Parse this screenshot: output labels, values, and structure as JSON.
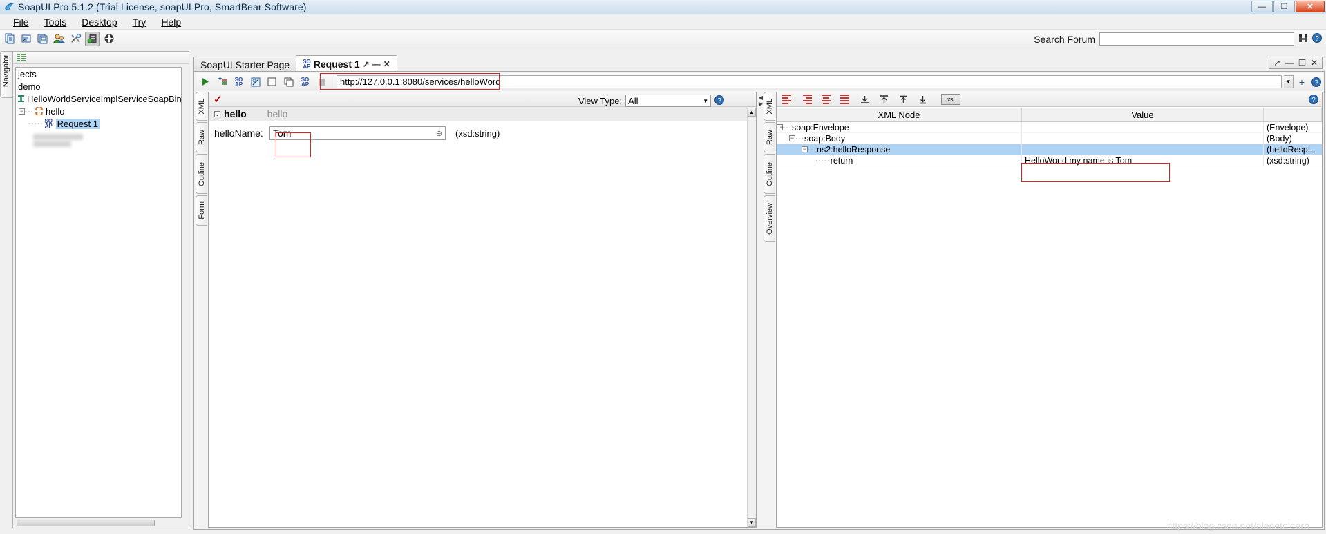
{
  "window": {
    "title": "SoapUI Pro 5.1.2 (Trial License, soapUI Pro, SmartBear Software)",
    "app_icon": "soapui-logo-icon",
    "minimize": "—",
    "restore": "❐",
    "close": "✕"
  },
  "menu": {
    "items": [
      {
        "label": "File"
      },
      {
        "label": "Tools"
      },
      {
        "label": "Desktop"
      },
      {
        "label": "Try"
      },
      {
        "label": "Help"
      }
    ]
  },
  "toolbar": {
    "buttons": [
      {
        "name": "new-project-icon",
        "glyph": "🗐"
      },
      {
        "name": "import-project-icon",
        "glyph": "🗗"
      },
      {
        "name": "save-all-icon",
        "glyph": "🗏"
      },
      {
        "name": "forum-icon",
        "glyph": "👥"
      },
      {
        "name": "preferences-icon",
        "glyph": "🛠"
      },
      {
        "name": "mockservice-icon",
        "glyph": "🖴"
      },
      {
        "name": "help-icon",
        "glyph": "✪"
      }
    ],
    "search_label": "Search Forum",
    "search_value": "",
    "search_placeholder": "",
    "search_go_icon": "binoculars-icon",
    "search_help_icon": "help-circle-icon"
  },
  "navigator": {
    "tab_label": "Navigator",
    "header_icon": "collapse-all-icon",
    "tree": [
      {
        "label": "jects",
        "indent": 0,
        "expander": "",
        "icon": ""
      },
      {
        "label": "demo",
        "indent": 0,
        "expander": "",
        "icon": ""
      },
      {
        "label": "HelloWorldServiceImplServiceSoapBind",
        "indent": 0,
        "expander": "",
        "icon": "interface-icon"
      },
      {
        "label": "hello",
        "indent": 1,
        "expander": "-",
        "icon": "operation-icon"
      },
      {
        "label": "Request 1",
        "indent": 2,
        "expander": "",
        "icon": "soap-request-icon",
        "selected": true
      }
    ]
  },
  "desktop": {
    "tabs": [
      {
        "label": "SoapUI Starter Page",
        "active": false,
        "icon": ""
      },
      {
        "label": "Request 1",
        "active": true,
        "icon": "soap-icon",
        "buttons": [
          "↗",
          "—",
          "✕"
        ]
      }
    ],
    "panel_buttons": [
      "↗",
      "—",
      "❐",
      "✕"
    ]
  },
  "request": {
    "toolbar_buttons": [
      {
        "name": "submit-request-button",
        "glyph": "▶"
      },
      {
        "name": "add-assertion-button",
        "glyph": "⁺"
      },
      {
        "name": "soap-format-button",
        "glyph": "SO"
      },
      {
        "name": "create-testcase-button",
        "glyph": "◳"
      },
      {
        "name": "one-way-button",
        "glyph": "◻"
      },
      {
        "name": "clone-request-button",
        "glyph": "❐"
      },
      {
        "name": "wsa-button",
        "glyph": "SO"
      },
      {
        "name": "stop-button",
        "glyph": "■"
      }
    ],
    "url": "http://127.0.0.1:8080/services/helloWord",
    "url_dropdown_icon": "chevron-down-icon",
    "add-endpoint-icon": "+",
    "help_icon": "help-circle-icon",
    "editor_tabs": [
      {
        "label": "XML",
        "active": true
      },
      {
        "label": "Raw",
        "active": false
      },
      {
        "label": "Outline",
        "active": false
      },
      {
        "label": "Form",
        "active": false
      }
    ],
    "validation_icon": "red-check-icon",
    "view_type_label": "View Type:",
    "view_type_value": "All",
    "view_type_options": [
      "All"
    ],
    "form": {
      "group_name": "hello",
      "group_hint": "hello",
      "expander": "⌄",
      "field_label": "helloName:",
      "field_value": "Tom",
      "field_clear_icon": "clear-icon",
      "field_type": "(xsd:string)"
    }
  },
  "response": {
    "editor_tabs": [
      {
        "label": "XML",
        "active": true
      },
      {
        "label": "Raw",
        "active": false
      },
      {
        "label": "Outline",
        "active": false
      },
      {
        "label": "Overview",
        "active": false
      }
    ],
    "toolbar_icons": [
      "align-left-icon",
      "align-right-icon",
      "align-center-icon",
      "align-justify-icon",
      "move-down-icon",
      "move-up-icon",
      "move-top-icon",
      "move-bottom-icon"
    ],
    "xsd_button": "xs:",
    "help_icon": "help-circle-icon",
    "columns": [
      "XML Node",
      "Value",
      ""
    ],
    "rows": [
      {
        "node": "soap:Envelope",
        "value": "",
        "type": "(Envelope)",
        "indent": 0,
        "expander": "-",
        "selected": false
      },
      {
        "node": "soap:Body",
        "value": "",
        "type": "(Body)",
        "indent": 1,
        "expander": "-",
        "selected": false
      },
      {
        "node": "ns2:helloResponse",
        "value": "",
        "type": "(helloResp...",
        "indent": 2,
        "expander": "-",
        "selected": true
      },
      {
        "node": "return",
        "value": "HelloWorld my name is Tom",
        "type": "(xsd:string)",
        "indent": 3,
        "expander": "",
        "selected": false
      }
    ]
  },
  "watermark": "https://blog.csdn.net/alonetolearn",
  "colors": {
    "highlight_box": "#e02020",
    "selection": "#aed3f5",
    "accent_green": "#1e8b1e"
  }
}
